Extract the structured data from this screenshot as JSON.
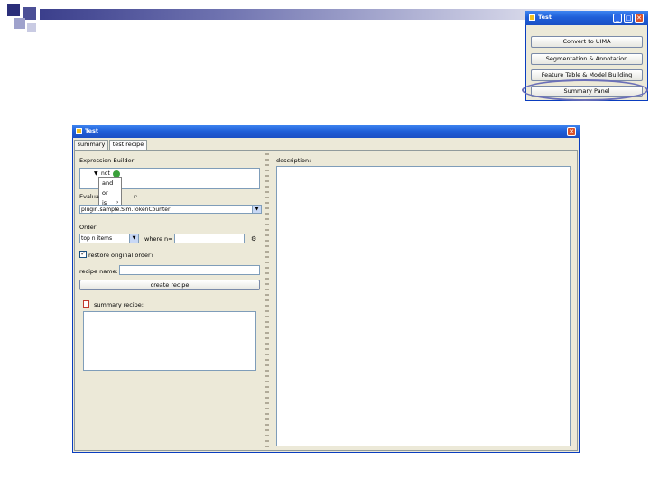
{
  "small_window": {
    "title": "Test",
    "buttons": [
      "Convert to UIMA",
      "Segmentation & Annotation",
      "Feature Table & Model Building",
      "Summary Panel"
    ]
  },
  "main_window": {
    "title": "Test",
    "tabs": [
      "summary",
      "test recipe"
    ],
    "expression_builder_label": "Expression Builder:",
    "expression_current": "not",
    "operator_menu": [
      "and",
      "or",
      "is"
    ],
    "evaluator_label_left": "Evalua",
    "evaluator_label_right": "r:",
    "evaluator_value": "plugin.sample.Sim.TokenCounter",
    "order_label": "Order:",
    "order_value": "top n items",
    "where_n_label": "where n=",
    "where_n_value": "",
    "checkbox_label": "restore original order?",
    "recipe_name_label": "recipe name:",
    "recipe_name_value": "",
    "create_button": "create recipe",
    "summary_recipe_label": "summary recipe:",
    "description_label": "description:"
  }
}
